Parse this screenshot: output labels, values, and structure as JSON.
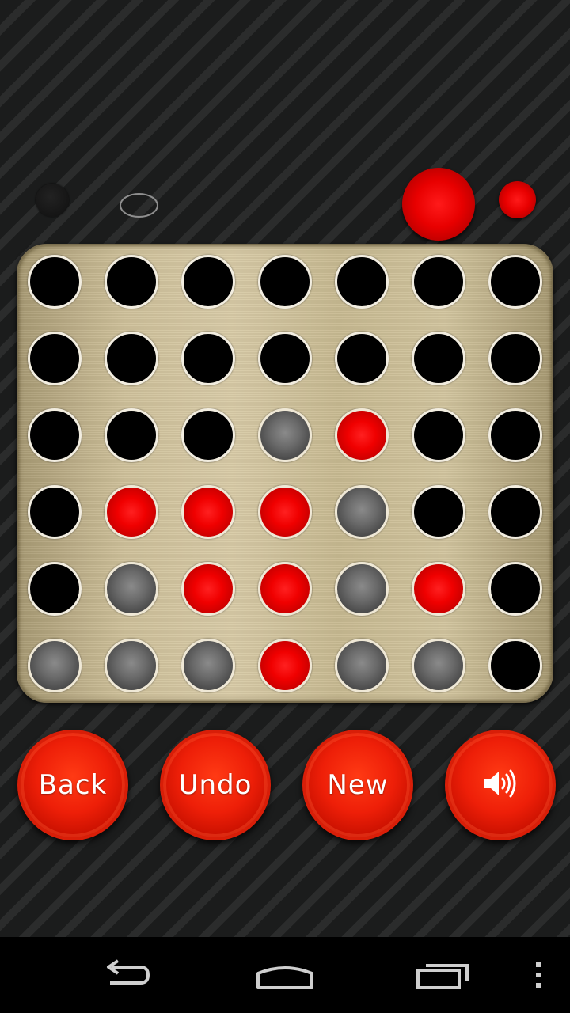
{
  "turn_indicators": {
    "player_one": "dark",
    "player_two": "empty-outline",
    "current_player": "red"
  },
  "board": {
    "columns": 7,
    "rows": 6,
    "grid": [
      [
        "empty",
        "empty",
        "empty",
        "empty",
        "empty",
        "empty",
        "empty"
      ],
      [
        "empty",
        "empty",
        "empty",
        "empty",
        "empty",
        "empty",
        "empty"
      ],
      [
        "empty",
        "empty",
        "empty",
        "gray",
        "red",
        "empty",
        "empty"
      ],
      [
        "empty",
        "red",
        "red",
        "red",
        "gray",
        "empty",
        "empty"
      ],
      [
        "empty",
        "gray",
        "red",
        "red",
        "gray",
        "red",
        "empty"
      ],
      [
        "gray",
        "gray",
        "gray",
        "red",
        "gray",
        "gray",
        "empty"
      ]
    ]
  },
  "buttons": {
    "back_label": "Back",
    "undo_label": "Undo",
    "new_label": "New",
    "sound_icon": "speaker-icon"
  },
  "colors": {
    "red_piece": "#e80000",
    "gray_piece": "#6a6a6a",
    "board": "#cfc19b",
    "button": "#ee1f08"
  },
  "navbar": {
    "back_icon": "nav-back-icon",
    "home_icon": "nav-home-icon",
    "recents_icon": "nav-recents-icon",
    "menu_icon": "overflow-menu-icon"
  }
}
